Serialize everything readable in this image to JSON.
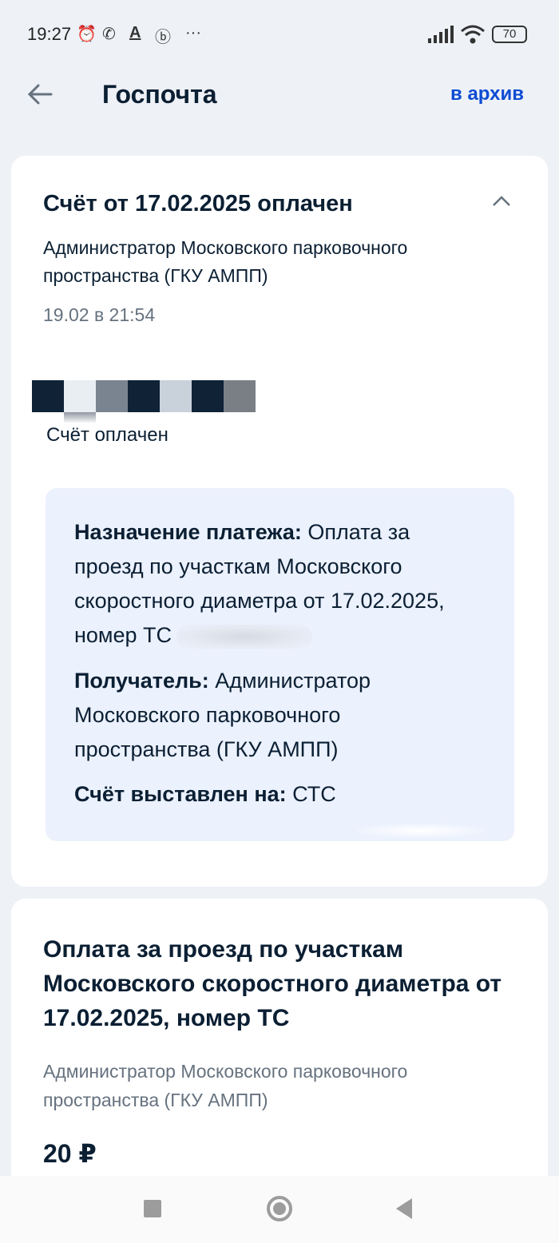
{
  "status_bar": {
    "time": "19:27",
    "icons": [
      "alarm-icon",
      "whatsapp-icon",
      "a-icon",
      "b-icon",
      "more-icon",
      "signal-icon",
      "wifi-icon",
      "battery-icon"
    ],
    "more": "···",
    "battery": "70"
  },
  "header": {
    "title": "Госпочта",
    "archive_label": "в архив"
  },
  "invoice_card": {
    "title": "Счёт от 17.02.2025 оплачен",
    "sender": "Администратор Московского парковочного пространства (ГКУ АМПП)",
    "date": "19.02 в 21:54",
    "status": "Счёт оплачен",
    "stamp_colors": [
      "#0f2236",
      "#e9eef3",
      "#7a8491",
      "#0f2236",
      "#c9d1db",
      "#0f2236",
      "#7a7f86"
    ],
    "details": {
      "purpose_label": "Назначение платежа:",
      "purpose_value": "Оплата за проезд по участкам Московского скоростного диаметра от 17.02.2025, номер ТС",
      "recipient_label": "Получатель:",
      "recipient_value": "Администратор Московского парковочного пространства (ГКУ АМПП)",
      "issued_label": "Счёт выставлен на:",
      "issued_value": "СТС"
    }
  },
  "payment_card": {
    "title": "Оплата за проезд по участкам Московского скоростного диаметра от 17.02.2025, номер ТС",
    "sender": "Администратор Московского парковочного пространства (ГКУ АМПП)",
    "amount": "20 ₽"
  },
  "colors": {
    "accent": "#0d4cd3",
    "background": "#eef1f6",
    "details_bg": "#ebf1fd",
    "text": "#0b1f33",
    "muted": "#66727f"
  }
}
